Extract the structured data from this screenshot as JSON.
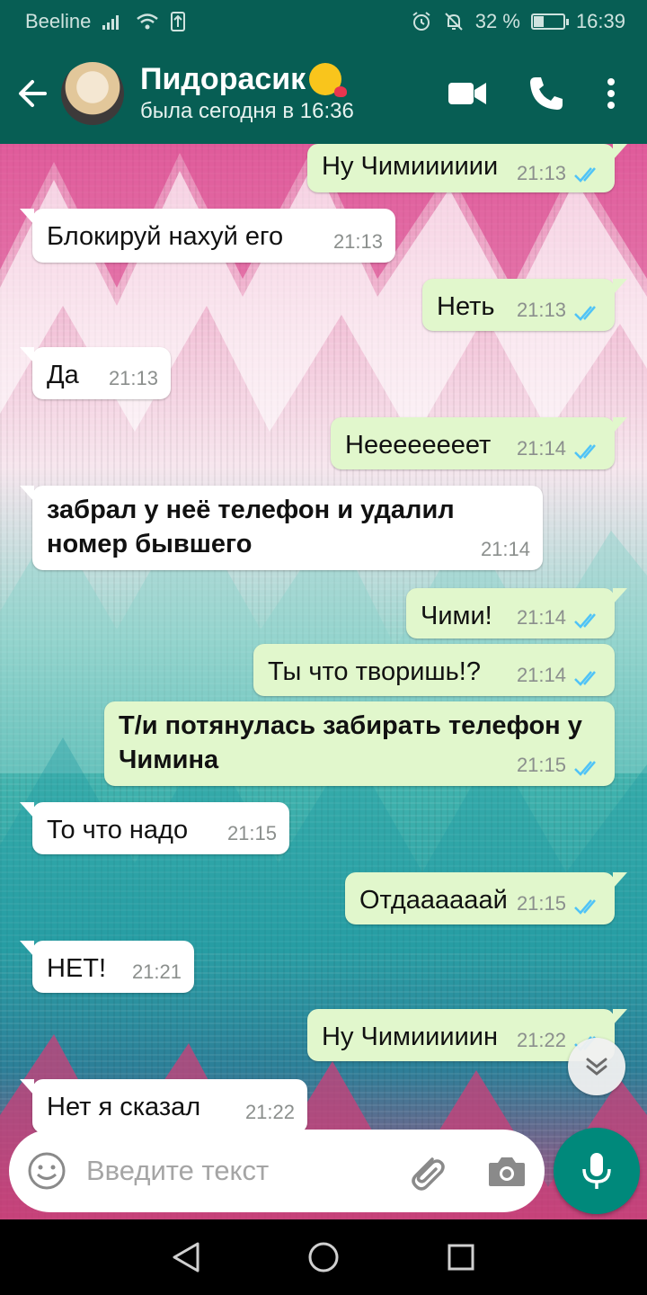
{
  "status_bar": {
    "carrier": "Beeline",
    "battery": "32 %",
    "battery_level": 0.32,
    "time": "16:39"
  },
  "header": {
    "contact_name": "Пидорасик",
    "contact_status": "была сегодня в 16:36",
    "icons": [
      "back-arrow-icon",
      "video-call-icon",
      "phone-icon",
      "more-options-icon"
    ]
  },
  "messages": [
    {
      "direction": "out",
      "text": "Ну Чимииииии",
      "time": "21:13",
      "read": true
    },
    {
      "direction": "in",
      "text": "Блокируй нахуй его",
      "time": "21:13"
    },
    {
      "direction": "out",
      "text": "Неть",
      "time": "21:13",
      "read": true
    },
    {
      "direction": "in",
      "text": "Да",
      "time": "21:13"
    },
    {
      "direction": "out",
      "text": "Неееееееет",
      "time": "21:14",
      "read": true
    },
    {
      "direction": "in",
      "text": "забрал у неё телефон и удалил номер бывшего",
      "time": "21:14",
      "bold": true
    },
    {
      "direction": "out",
      "text": "Чими!",
      "time": "21:14",
      "read": true
    },
    {
      "direction": "out",
      "text": "Ты что творишь!?",
      "time": "21:14",
      "read": true
    },
    {
      "direction": "out",
      "text": "Т/и потянулась забирать телефон у Чимина",
      "time": "21:15",
      "read": true,
      "bold": true
    },
    {
      "direction": "in",
      "text": "То что надо",
      "time": "21:15"
    },
    {
      "direction": "out",
      "text": "Отдаааааай",
      "time": "21:15",
      "read": true
    },
    {
      "direction": "in",
      "text": "НЕТ!",
      "time": "21:21"
    },
    {
      "direction": "out",
      "text": "Ну Чимииииин",
      "time": "21:22",
      "read": true
    },
    {
      "direction": "in",
      "text": "Нет я сказал",
      "time": "21:22"
    }
  ],
  "composer": {
    "placeholder": "Введите текст"
  },
  "colors": {
    "header": "#075e54",
    "outgoing_bubble": "#e1f7cc",
    "incoming_bubble": "#ffffff",
    "read_ticks": "#4fc3f7",
    "mic_button": "#00897b"
  }
}
